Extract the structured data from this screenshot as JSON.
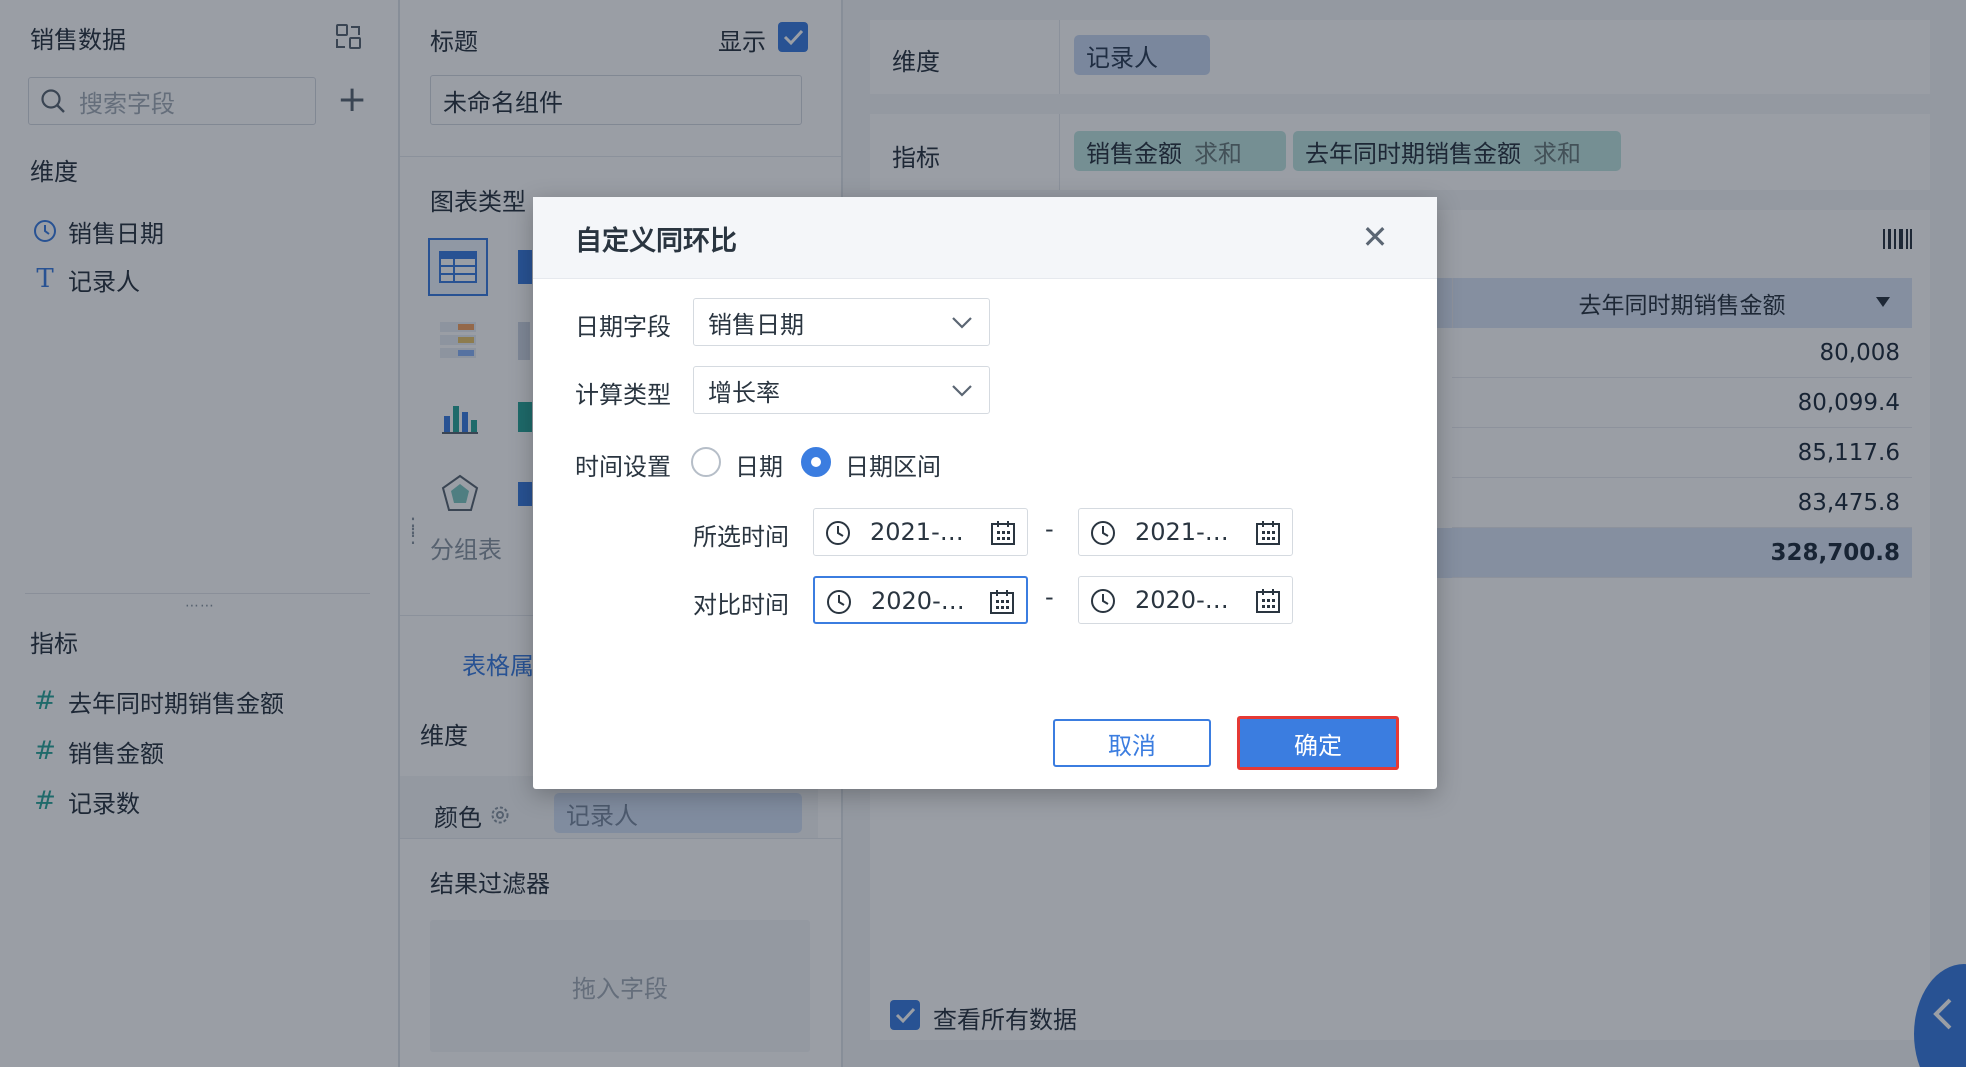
{
  "left": {
    "dataset_title": "销售数据",
    "search_placeholder": "搜索字段",
    "dimension_header": "维度",
    "dimensions": [
      "销售日期",
      "记录人"
    ],
    "measure_header": "指标",
    "measures": [
      "去年同时期销售金额",
      "销售金额",
      "记录数"
    ]
  },
  "middle": {
    "title_label": "标题",
    "show_label": "显示",
    "title_value": "未命名组件",
    "chart_type_label": "图表类型",
    "group_table_label": "分组表",
    "table_props_tab": "表格属",
    "dimension_label": "维度",
    "color_label": "颜色",
    "color_chip": "记录人",
    "result_filter_label": "结果过滤器",
    "drop_field_placeholder": "拖入字段"
  },
  "right": {
    "dimension_label": "维度",
    "dimension_chip": "记录人",
    "measure_label": "指标",
    "measure_chips": [
      {
        "name": "销售金额",
        "agg": "求和"
      },
      {
        "name": "去年同时期销售金额",
        "agg": "求和"
      }
    ],
    "table_header": "去年同时期销售金额",
    "table_values": [
      "80,008",
      "80,099.4",
      "85,117.6",
      "83,475.8"
    ],
    "table_total": "328,700.8",
    "view_all_label": "查看所有数据"
  },
  "dialog": {
    "title": "自定义同环比",
    "date_field_label": "日期字段",
    "date_field_value": "销售日期",
    "calc_type_label": "计算类型",
    "calc_type_value": "增长率",
    "time_setting_label": "时间设置",
    "radio_date": "日期",
    "radio_range": "日期区间",
    "selected_time_label": "所选时间",
    "compare_time_label": "对比时间",
    "selected_start": "2021-…",
    "selected_end": "2021-…",
    "compare_start": "2020-…",
    "compare_end": "2020-…",
    "dash": "-",
    "cancel_label": "取消",
    "ok_label": "确定"
  },
  "colors": {
    "accent": "#3b7de0",
    "highlight_border": "#e53935",
    "measure_chip": "#bfe5e1",
    "dimension_chip": "#c9d8f1"
  }
}
